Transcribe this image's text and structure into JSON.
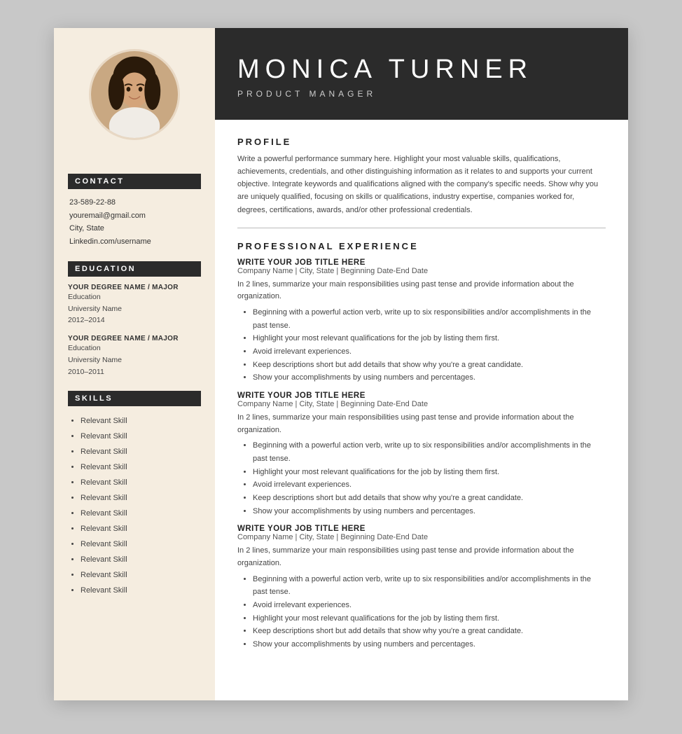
{
  "header": {
    "name": "MONICA  TURNER",
    "title": "PRODUCT  MANAGER"
  },
  "sidebar": {
    "contact_label": "CONTACT",
    "contact": {
      "phone": "23-589-22-88",
      "email": "youremail@gmail.com",
      "location": "City, State",
      "linkedin": "Linkedin.com/username"
    },
    "education_label": "EDUCATION",
    "education": [
      {
        "degree": "YOUR DEGREE NAME / MAJOR",
        "label": "Education",
        "university": "University Name",
        "years": "2012–2014"
      },
      {
        "degree": "YOUR DEGREE NAME / MAJOR",
        "label": "Education",
        "university": "University Name",
        "years": "2010–2011"
      }
    ],
    "skills_label": "SKILLS",
    "skills": [
      "Relevant Skill",
      "Relevant Skill",
      "Relevant Skill",
      "Relevant Skill",
      "Relevant Skill",
      "Relevant Skill",
      "Relevant Skill",
      "Relevant Skill",
      "Relevant Skill",
      "Relevant Skill",
      "Relevant Skill",
      "Relevant Skill"
    ]
  },
  "main": {
    "profile_label": "PROFILE",
    "profile_text": "Write a powerful performance summary here. Highlight your most valuable skills, qualifications, achievements, credentials, and other distinguishing information as it relates to and supports your current objective. Integrate keywords and qualifications aligned with the company's specific needs. Show why you are uniquely qualified, focusing on skills or qualifications, industry expertise, companies worked for, degrees, certifications, awards, and/or other professional credentials.",
    "experience_label": "PROFESSIONAL  EXPERIENCE",
    "jobs": [
      {
        "title": "WRITE YOUR JOB TITLE HERE",
        "meta": "Company Name | City, State | Beginning Date-End Date",
        "description": "In 2 lines, summarize your main responsibilities using past tense and provide information about the organization.",
        "bullets": [
          "Beginning with a powerful action verb, write up to six responsibilities and/or accomplishments in the past tense.",
          "Highlight your most relevant qualifications for the job by listing them first.",
          "Avoid irrelevant experiences.",
          "Keep descriptions short but add details that show why you're a great candidate.",
          "Show your accomplishments by using numbers and percentages."
        ]
      },
      {
        "title": "WRITE YOUR JOB TITLE HERE",
        "meta": "Company Name | City, State | Beginning Date-End Date",
        "description": "In 2 lines, summarize your main responsibilities using past tense and provide information about the organization.",
        "bullets": [
          "Beginning with a powerful action verb, write up to six responsibilities and/or accomplishments in the past tense.",
          "Highlight your most relevant qualifications for the job by listing them first.",
          "Avoid irrelevant experiences.",
          "Keep descriptions short but add details that show why you're a great candidate.",
          "Show your accomplishments by using numbers and percentages."
        ]
      },
      {
        "title": "WRITE YOUR JOB TITLE HERE",
        "meta": "Company Name | City, State | Beginning Date-End Date",
        "description": "In 2 lines, summarize your main responsibilities using past tense and provide information about the organization.",
        "bullets": [
          "Beginning with a powerful action verb, write up to six responsibilities and/or accomplishments in the past tense.",
          "Avoid irrelevant experiences.",
          "Highlight your most relevant qualifications for the job by listing them first.",
          "Keep descriptions short but add details that show why you're a great candidate.",
          "Show your accomplishments by using numbers and percentages."
        ]
      }
    ]
  }
}
